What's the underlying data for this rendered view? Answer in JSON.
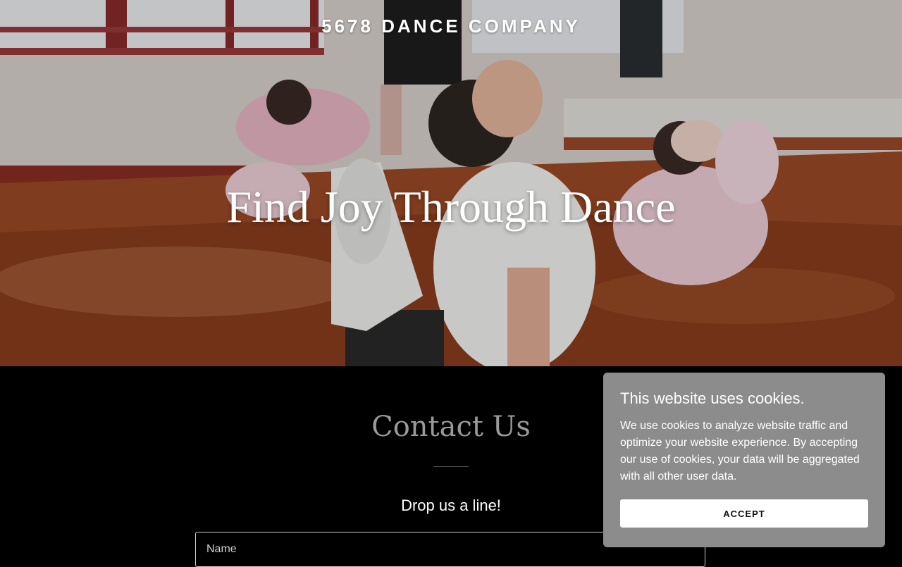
{
  "site": {
    "brand": "5678 DANCE COMPANY"
  },
  "hero": {
    "title": "Find Joy Through Dance",
    "image": "kids-dance-class-photo"
  },
  "contact": {
    "title": "Contact Us",
    "tagline": "Drop us a line!",
    "name_placeholder": "Name"
  },
  "cookie_banner": {
    "title": "This website uses cookies.",
    "body": "We use cookies to analyze website traffic and optimize your website experience. By accepting our use of cookies, your data will be aggregated with all other user data.",
    "accept_label": "ACCEPT"
  }
}
